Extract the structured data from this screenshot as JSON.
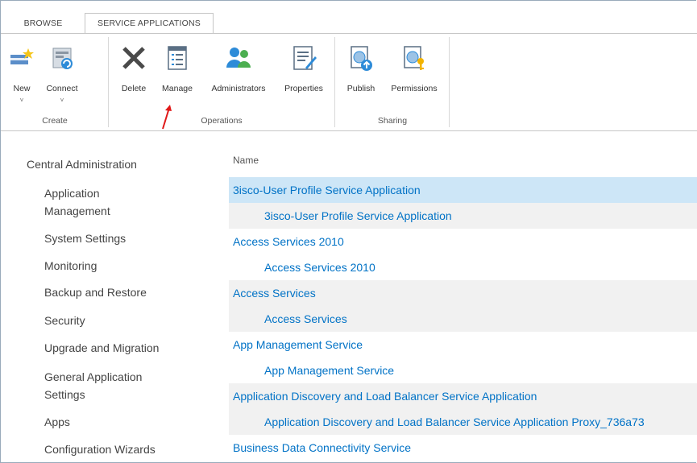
{
  "tabs": [
    {
      "label": "BROWSE"
    },
    {
      "label": "SERVICE APPLICATIONS"
    }
  ],
  "ribbon": {
    "buttons": [
      {
        "label": "New",
        "icon": "new-icon"
      },
      {
        "label": "Connect",
        "icon": "connect-icon"
      },
      {
        "label": "Delete",
        "icon": "delete-icon"
      },
      {
        "label": "Manage",
        "icon": "manage-icon"
      },
      {
        "label": "Administrators",
        "icon": "administrators-icon"
      },
      {
        "label": "Properties",
        "icon": "properties-icon"
      },
      {
        "label": "Publish",
        "icon": "publish-icon"
      },
      {
        "label": "Permissions",
        "icon": "permissions-icon"
      }
    ],
    "groups": [
      {
        "label": "Create"
      },
      {
        "label": "Operations"
      },
      {
        "label": "Sharing"
      }
    ],
    "dropdown_glyph": "˅"
  },
  "nav": {
    "heading": "Central Administration",
    "items": [
      {
        "label": "Application"
      },
      {
        "label": "Management"
      },
      {
        "label": "System Settings"
      },
      {
        "label": "Monitoring"
      },
      {
        "label": "Backup and Restore"
      },
      {
        "label": "Security"
      },
      {
        "label": "Upgrade and Migration"
      },
      {
        "label": "General Application"
      },
      {
        "label": "Settings"
      },
      {
        "label": "Apps"
      },
      {
        "label": "Configuration Wizards"
      }
    ]
  },
  "list": {
    "column_header": "Name",
    "rows": [
      {
        "text": "3isco-User Profile Service Application",
        "kind": "parent"
      },
      {
        "text": "3isco-User Profile Service Application",
        "kind": "child"
      },
      {
        "text": "Access Services 2010",
        "kind": "parent"
      },
      {
        "text": "Access Services 2010",
        "kind": "child"
      },
      {
        "text": "Access Services",
        "kind": "parent"
      },
      {
        "text": "Access Services",
        "kind": "child"
      },
      {
        "text": "App Management Service",
        "kind": "parent"
      },
      {
        "text": "App Management Service",
        "kind": "child"
      },
      {
        "text": "Application Discovery and Load Balancer Service Application",
        "kind": "parent"
      },
      {
        "text": "Application Discovery and Load Balancer Service Application Proxy_736a73",
        "kind": "child"
      },
      {
        "text": "Business Data Connectivity Service",
        "kind": "parent"
      }
    ]
  },
  "colors": {
    "link": "#0072c6",
    "selected_row": "#cde6f7",
    "alt_row": "#f1f1f1",
    "annotation_arrow": "#e01818"
  }
}
